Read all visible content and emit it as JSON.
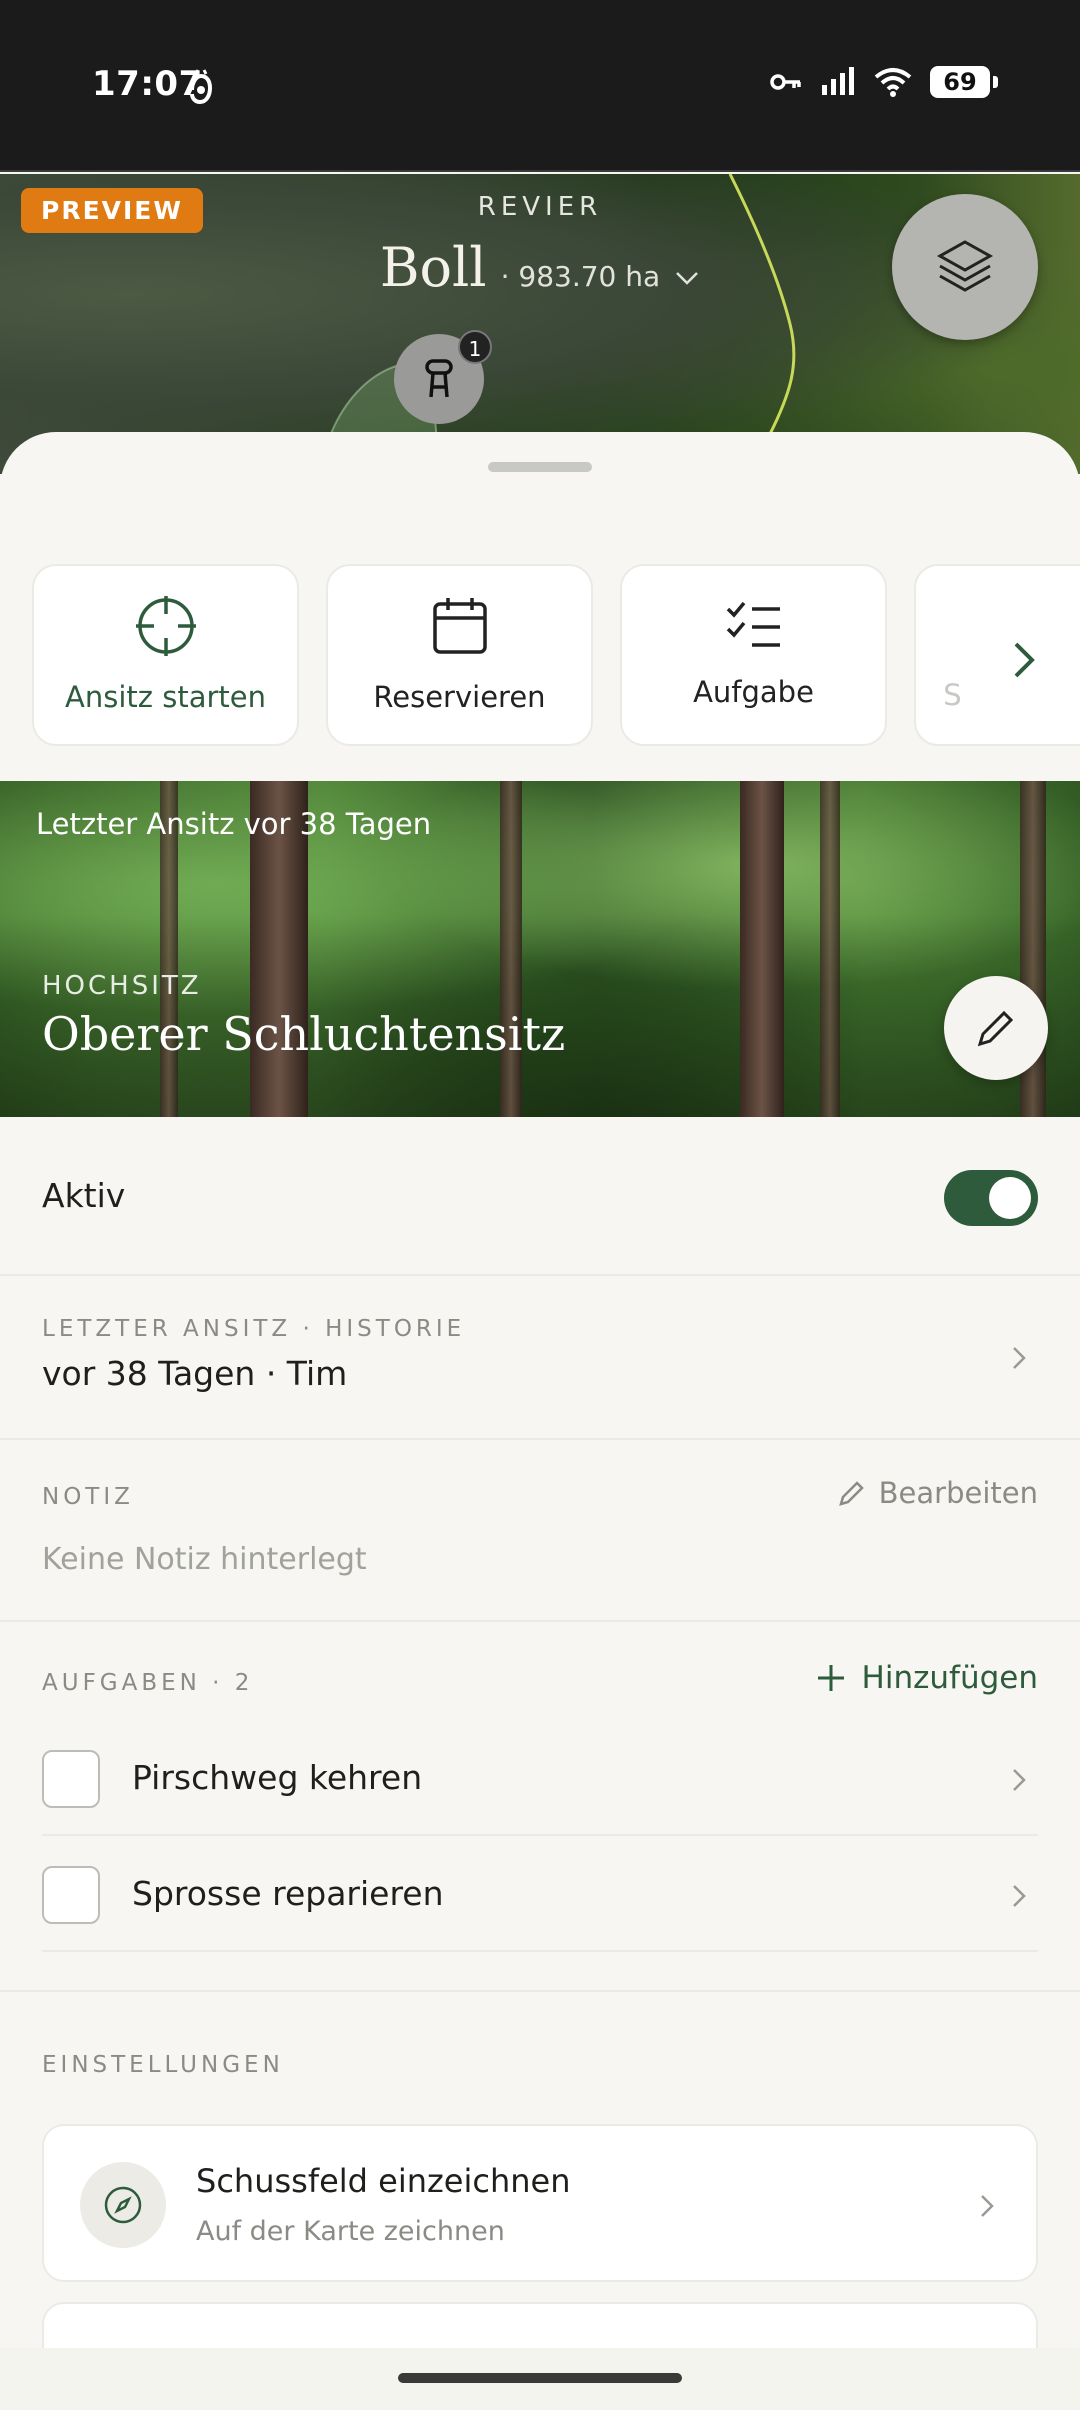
{
  "status_bar": {
    "time": "17:07",
    "battery": "69",
    "icons": [
      "app-notification-icon",
      "vpn-key-icon",
      "signal-icon",
      "wifi-icon",
      "battery-icon"
    ]
  },
  "map": {
    "badge": "PREVIEW",
    "revier_label": "REVIER",
    "revier_name": "Boll",
    "revier_area": "· 983.70 ha",
    "marker_count": "1",
    "icons": [
      "layers-icon",
      "hochsitz-marker-icon",
      "chevron-down-icon"
    ]
  },
  "actions": [
    {
      "label": "Ansitz starten",
      "icon": "crosshair-icon"
    },
    {
      "label": "Reservieren",
      "icon": "calendar-icon"
    },
    {
      "label": "Aufgabe",
      "icon": "checklist-icon"
    },
    {
      "label": "S",
      "icon": ""
    }
  ],
  "photo": {
    "last_visit": "Letzter Ansitz vor 38 Tagen",
    "category": "HOCHSITZ",
    "title": "Oberer Schluchtensitz"
  },
  "aktiv": {
    "label": "Aktiv",
    "enabled": true
  },
  "history": {
    "eyebrow": "LETZTER ANSITZ · HISTORIE",
    "value": "vor 38 Tagen · Tim"
  },
  "note": {
    "eyebrow": "NOTIZ",
    "edit_label": "Bearbeiten",
    "empty_text": "Keine Notiz hinterlegt"
  },
  "tasks": {
    "eyebrow": "AUFGABEN · 2",
    "add_label": "Hinzufügen",
    "items": [
      {
        "label": "Pirschweg kehren"
      },
      {
        "label": "Sprosse reparieren"
      }
    ]
  },
  "settings": {
    "eyebrow": "EINSTELLUNGEN",
    "items": [
      {
        "title": "Schussfeld einzeichnen",
        "subtitle": "Auf der Karte zeichnen",
        "icon": "compass-icon"
      }
    ]
  },
  "colors": {
    "accent": "#2d5b3c",
    "preview": "#e07a12",
    "background": "#f7f6f2"
  }
}
